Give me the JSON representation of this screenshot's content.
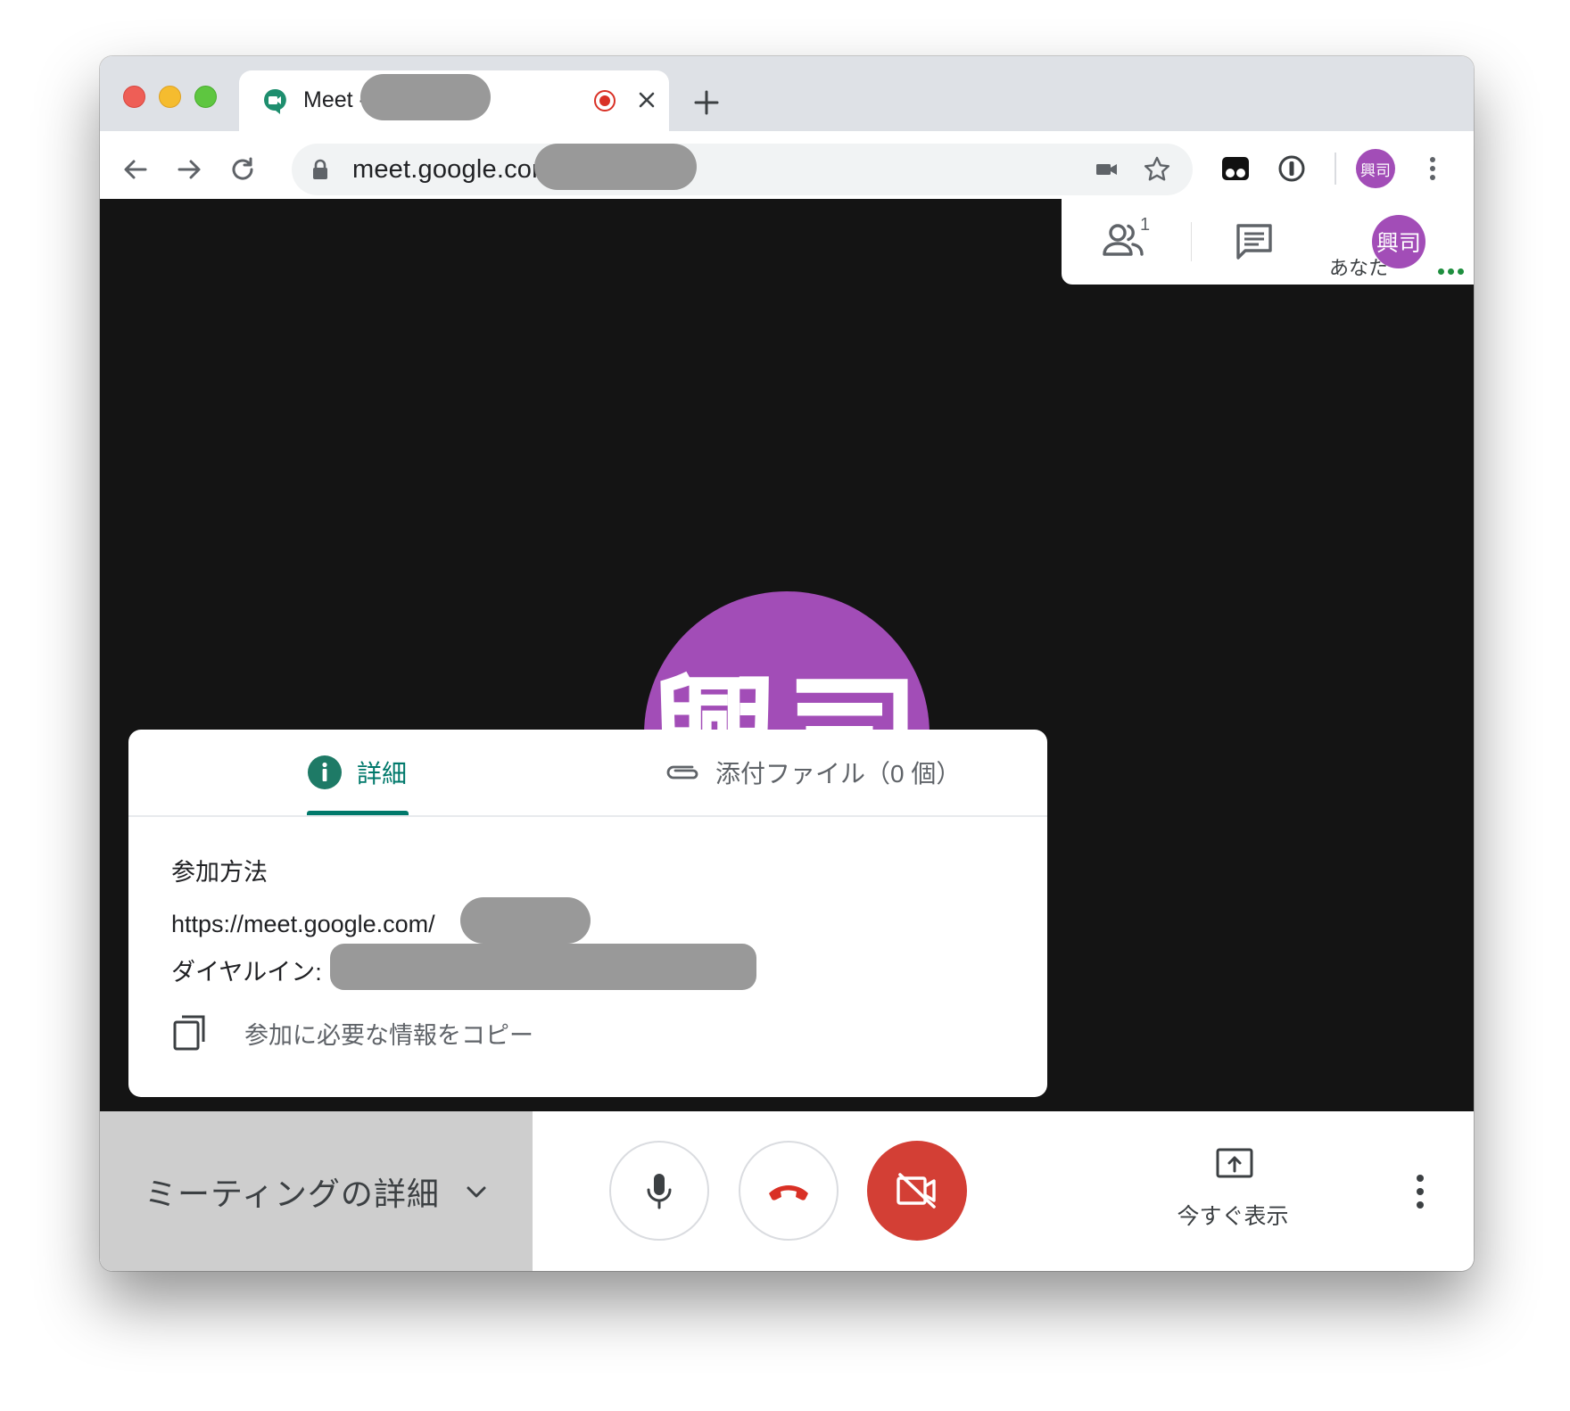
{
  "browser": {
    "tab": {
      "title": "Meet -"
    },
    "url": "meet.google.com/",
    "profile_initials": "興司"
  },
  "meet": {
    "top_panel": {
      "participant_count": "1",
      "you_initials": "興司",
      "you_label": "あなた"
    },
    "tile_initials": "興司",
    "details_card": {
      "tabs": [
        {
          "label": "詳細",
          "active": true
        },
        {
          "label": "添付ファイル（0 個）",
          "active": false
        }
      ],
      "join_heading": "参加方法",
      "join_url": "https://meet.google.com/",
      "dial_in_label": "ダイヤルイン:",
      "copy_label": "参加に必要な情報をコピー"
    },
    "bottom_bar": {
      "meeting_details_label": "ミーティングの詳細",
      "present_label": "今すぐ表示"
    }
  },
  "colors": {
    "accent_teal": "#00796b",
    "avatar_purple": "#a24db7",
    "hangup_red": "#d93025",
    "camera_off_red": "#d33f35",
    "stage_background": "#141414"
  }
}
